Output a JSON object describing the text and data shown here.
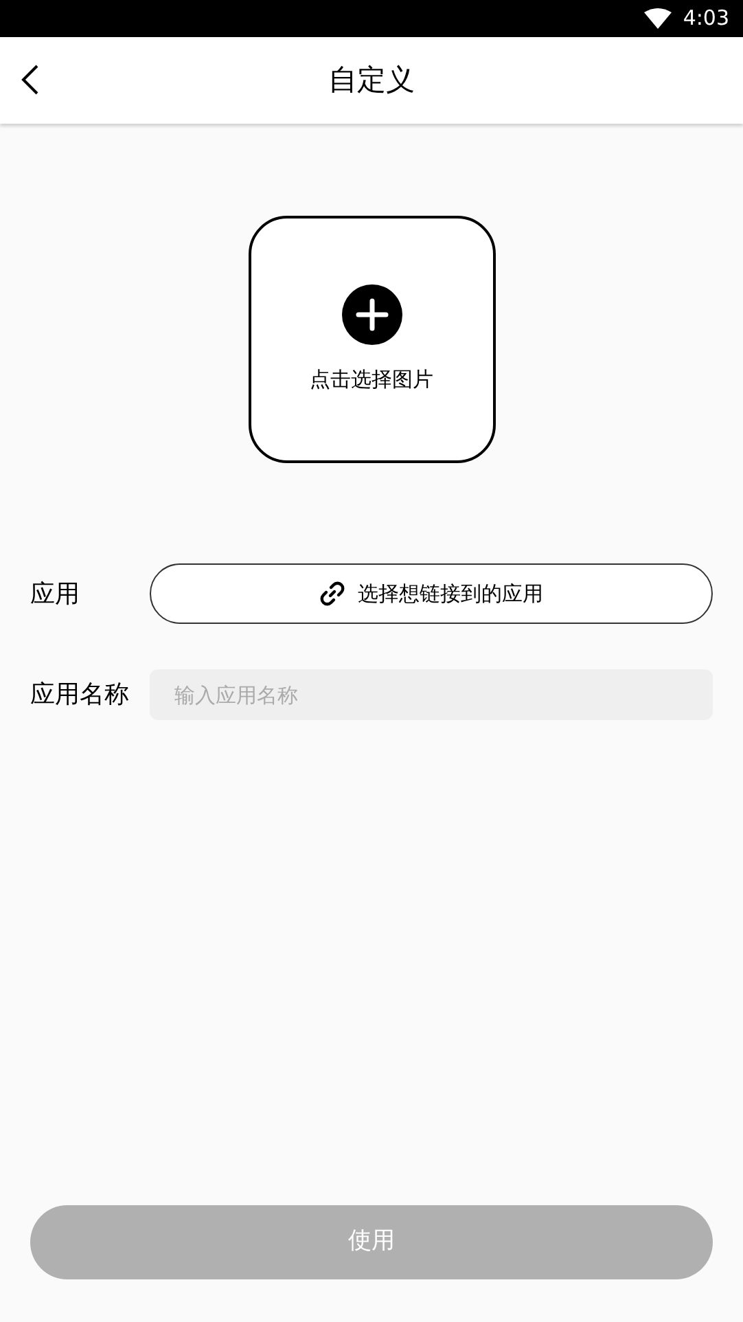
{
  "status_bar": {
    "time": "4:03"
  },
  "header": {
    "title": "自定义"
  },
  "image_picker": {
    "label": "点击选择图片"
  },
  "form": {
    "app_label": "应用",
    "app_button": "选择想链接到的应用",
    "name_label": "应用名称",
    "name_field": {
      "placeholder": "输入应用名称"
    }
  },
  "use_button": {
    "label": "使用",
    "disabled": true
  }
}
